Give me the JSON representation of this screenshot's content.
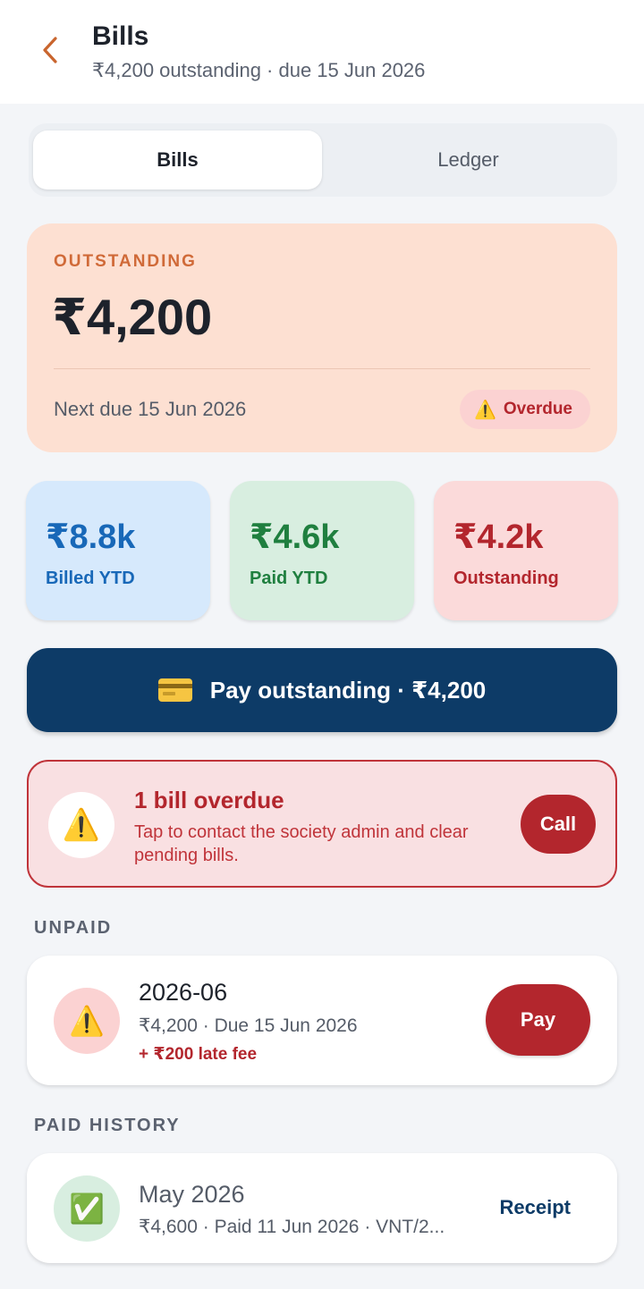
{
  "header": {
    "back_icon": "chevron-left-icon",
    "accent": "#c9652e",
    "title": "Bills",
    "subtitle": "₹4,200 outstanding · due 15 Jun 2026"
  },
  "tabs": [
    {
      "label": "Bills",
      "active": true
    },
    {
      "label": "Ledger",
      "active": false
    }
  ],
  "summary": {
    "label": "OUTSTANDING",
    "amount": "₹4,200",
    "next_due": "Next due 15 Jun 2026",
    "badge_icon": "warning-icon",
    "badge_glyph": "⚠️",
    "badge_text": "Overdue"
  },
  "stats": [
    {
      "value": "₹8.8k",
      "label": "Billed YTD",
      "color": "#1868b8"
    },
    {
      "value": "₹4.6k",
      "label": "Paid YTD",
      "color": "#1f7f3f"
    },
    {
      "value": "₹4.2k",
      "label": "Outstanding",
      "color": "#b3262d"
    }
  ],
  "pay_button": {
    "icon": "credit-card-icon",
    "label": "Pay outstanding · ₹4,200",
    "color": "#0d3b67"
  },
  "alert": {
    "icon": "warning-icon",
    "glyph": "⚠️",
    "title": "1 bill overdue",
    "body": "Tap to contact the society admin and clear pending bills.",
    "button": "Call"
  },
  "unpaid": {
    "section_label": "UNPAID",
    "items": [
      {
        "icon": "warning-icon",
        "glyph": "⚠️",
        "period": "2026-06",
        "detail": "₹4,200 · Due 15 Jun 2026",
        "late_fee": "+ ₹200 late fee",
        "action": "Pay"
      }
    ]
  },
  "paid": {
    "section_label": "PAID HISTORY",
    "items": [
      {
        "icon": "check-icon",
        "glyph": "✅",
        "period": "May 2026",
        "detail": "₹4,600 · Paid 11 Jun 2026 · VNT/2...",
        "action": "Receipt"
      }
    ]
  }
}
